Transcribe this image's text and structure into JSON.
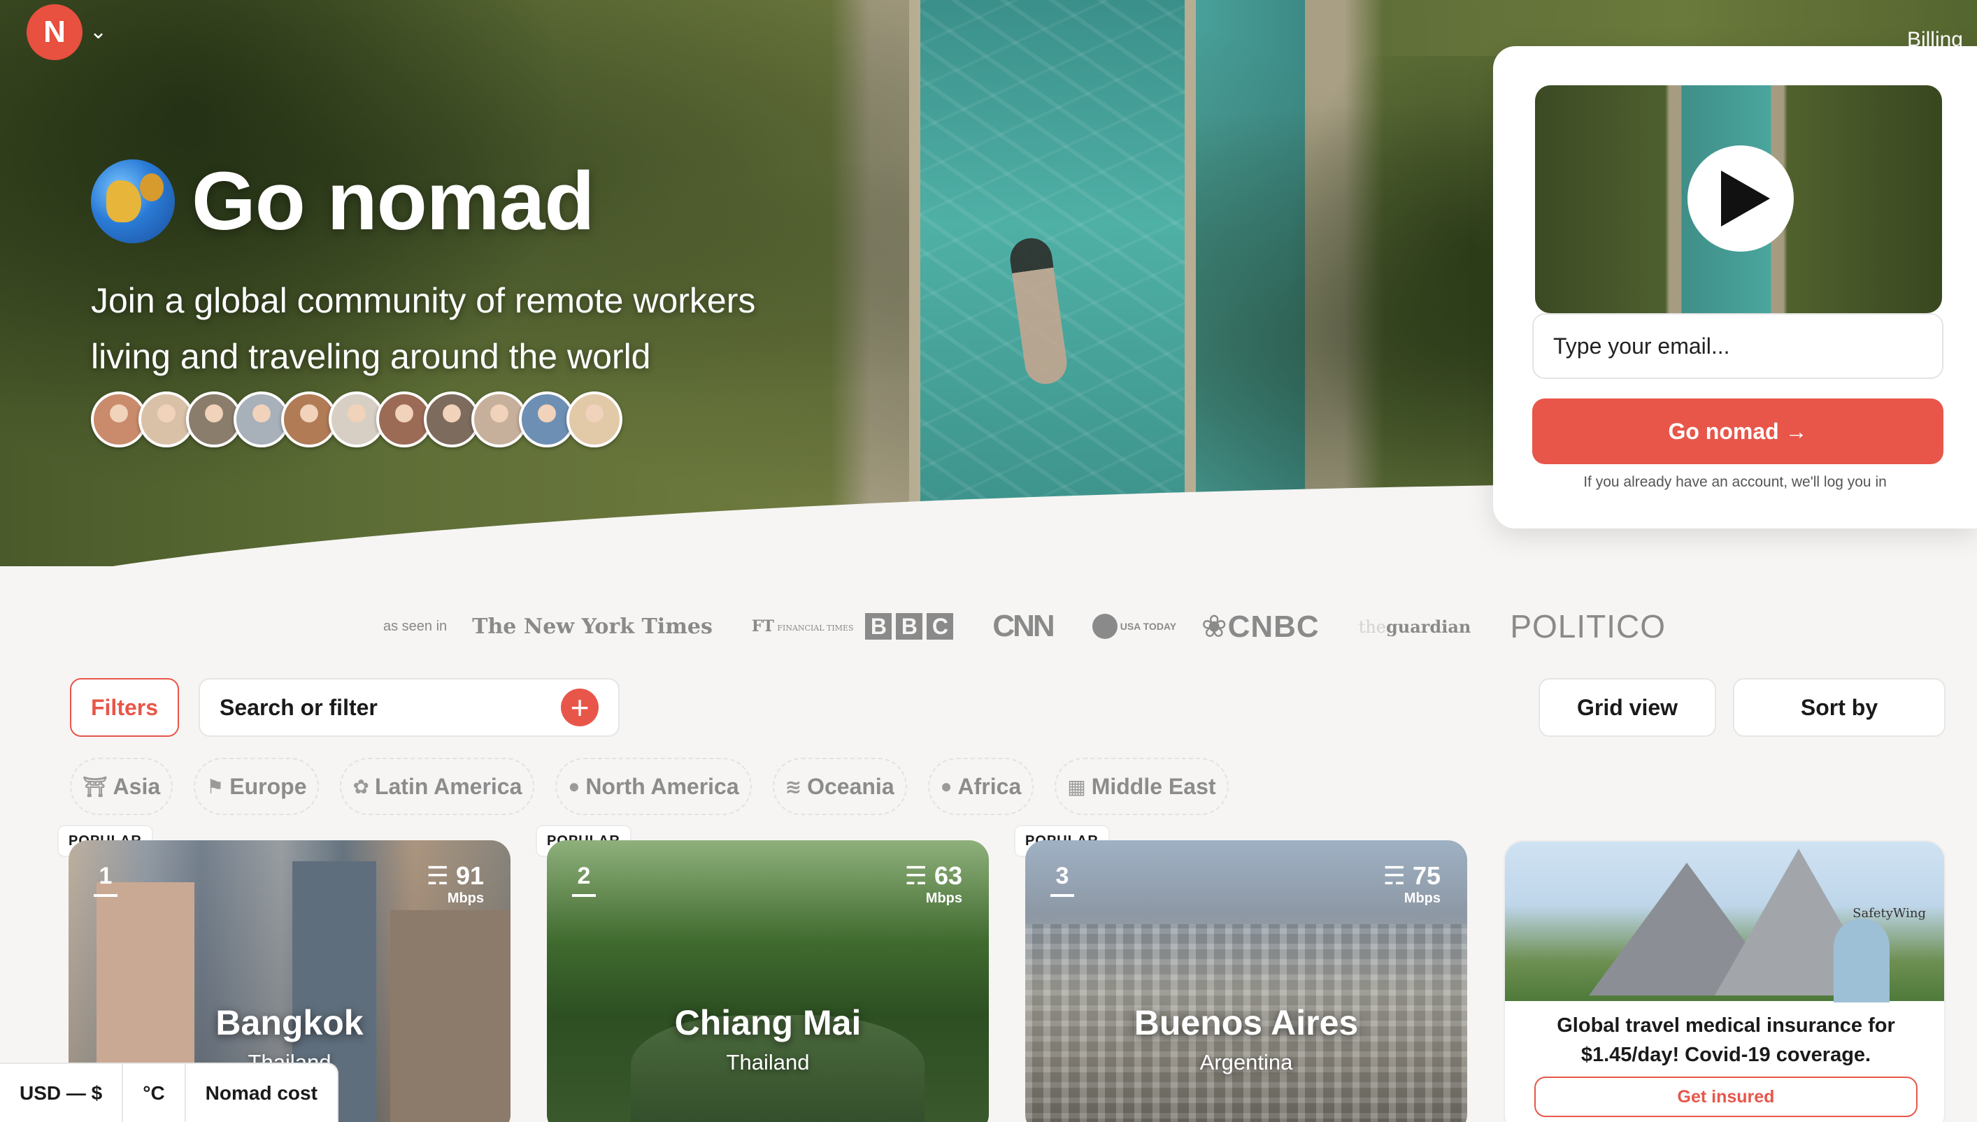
{
  "brand": {
    "logo_letter": "N"
  },
  "header": {
    "billing_label": "Billing"
  },
  "hero": {
    "title": "Go nomad",
    "subtitle_line1": "Join a global community of remote workers",
    "subtitle_line2": "living and traveling around the world",
    "avatar_colors": [
      "#c98b6b",
      "#d9c1a8",
      "#8a7d6c",
      "#a8b0b9",
      "#b07b55",
      "#d7cfc4",
      "#9c6b56",
      "#7d6b5d",
      "#c7b09b",
      "#6d8fb3",
      "#e2c9a8"
    ]
  },
  "signup": {
    "email_placeholder": "Type your email...",
    "button_label": "Go nomad →",
    "note": "If you already have an account, we'll log you in"
  },
  "press": {
    "as_seen_in": "as seen in",
    "nyt": "The New York Times",
    "ft_mark": "FT",
    "ft_text": "FINANCIAL TIMES",
    "bbc": [
      "B",
      "B",
      "C"
    ],
    "cnn": "CNN",
    "usa_today": "USA TODAY",
    "cnbc": "CNBC",
    "guardian_prefix": "the",
    "guardian": "guardian",
    "politico": "POLITICO"
  },
  "filters": {
    "filters_label": "Filters",
    "search_label": "Search or filter",
    "grid_view_label": "Grid view",
    "sort_by_label": "Sort by"
  },
  "regions": [
    {
      "icon": "torii-gate-icon",
      "label": "Asia",
      "glyph": "⛩"
    },
    {
      "icon": "flag-icon",
      "label": "Europe",
      "glyph": "⚑"
    },
    {
      "icon": "cactus-icon",
      "label": "Latin America",
      "glyph": "✿"
    },
    {
      "icon": "globe-americas-icon",
      "label": "North America",
      "glyph": "●"
    },
    {
      "icon": "surf-icon",
      "label": "Oceania",
      "glyph": "≋"
    },
    {
      "icon": "globe-africa-icon",
      "label": "Africa",
      "glyph": "●"
    },
    {
      "icon": "building-icon",
      "label": "Middle East",
      "glyph": "▦"
    }
  ],
  "cards": [
    {
      "badge": "POPULAR",
      "rank": "1",
      "mbps": "91",
      "unit": "Mbps",
      "city": "Bangkok",
      "country": "Thailand"
    },
    {
      "badge": "POPULAR",
      "rank": "2",
      "mbps": "63",
      "unit": "Mbps",
      "city": "Chiang Mai",
      "country": "Thailand"
    },
    {
      "badge": "POPULAR",
      "rank": "3",
      "mbps": "75",
      "unit": "Mbps",
      "city": "Buenos Aires",
      "country": "Argentina"
    }
  ],
  "ad": {
    "brand": "SafetyWing",
    "text": "Global travel medical insurance for $1.45/day! Covid-19 coverage.",
    "cta": "Get insured"
  },
  "bottom_bar": {
    "currency": "USD — $",
    "temperature": "°C",
    "cost": "Nomad cost"
  },
  "colors": {
    "accent": "#e8564a",
    "background": "#f6f5f3"
  }
}
